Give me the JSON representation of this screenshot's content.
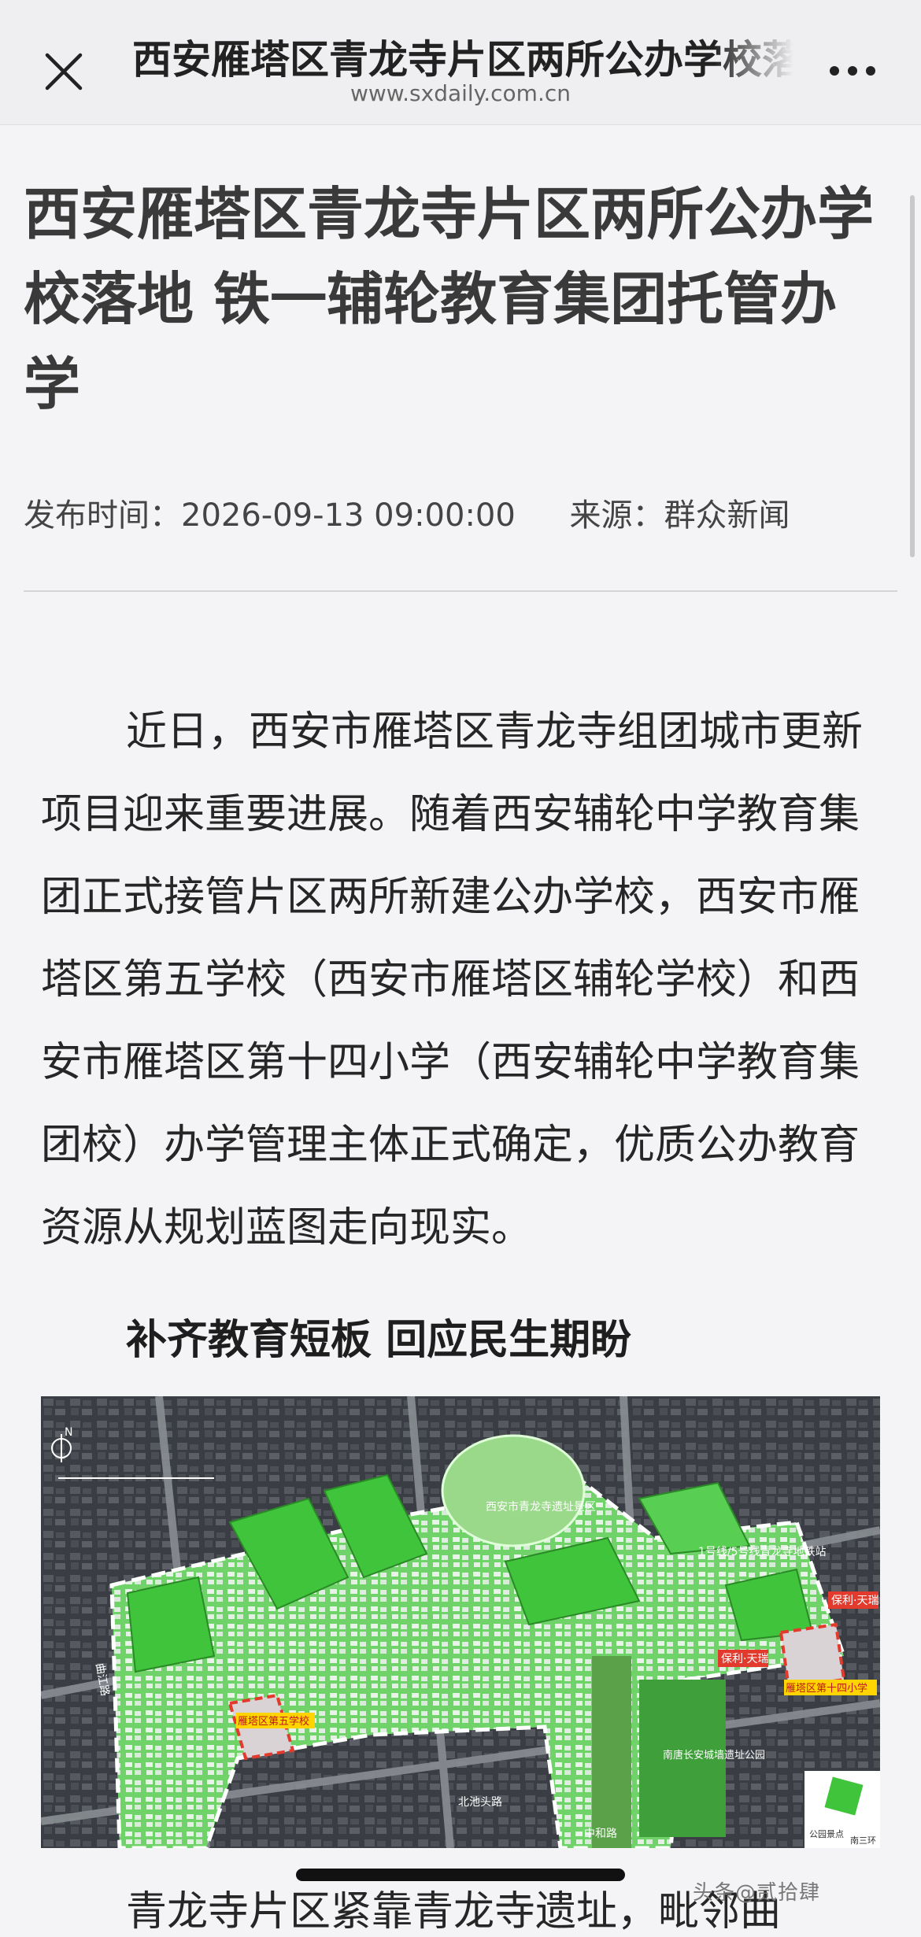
{
  "header": {
    "title": "西安雁塔区青龙寺片区两所公办学校落地 铁一辅轮教育集团托管办学",
    "domain": "www.sxdaily.com.cn"
  },
  "article": {
    "title": "西安雁塔区青龙寺片区两所公办学校落地 铁一辅轮教育集团托管办学",
    "publish_label": "发布时间：",
    "publish_time": "2026-09-13 09:00:00",
    "source_label": "来源：",
    "source": "群众新闻",
    "paragraph1": "近日，西安市雁塔区青龙寺组团城市更新项目迎来重要进展。随着西安辅轮中学教育集团正式接管片区两所新建公办学校，西安市雁塔区第五学校（西安市雁塔区辅轮学校）和西安市雁塔区第十四小学（西安辅轮中学教育集团校）办学管理主体正式确定，优质公办教育资源从规划蓝图走向现实。",
    "section_heading": "补齐教育短板 回应民生期盼",
    "next_paragraph_start": "青龙寺片区紧靠青龙寺遗址，毗邻曲"
  },
  "map": {
    "labels": {
      "site_park": "西安市青龙寺遗址景区",
      "metro_station": "1号线/5号线青龙寺地铁站",
      "poly_tianrui_1": "保利·天瑞",
      "poly_tianrui_2": "保利·天瑞",
      "school_5": "雁塔区第五学校",
      "school_14": "雁塔区第十四小学",
      "tang_park": "南唐长安城墙遗址公园",
      "road_west": "曲江路",
      "road_south": "北池头路",
      "road_mid": "中和路",
      "road_ring": "南三环",
      "legend_box": "公园景点"
    },
    "colors": {
      "green": "#3fc43b",
      "school_red": "#e23b2e",
      "label_yellow": "#ffd400",
      "boundary": "#ffffff"
    }
  },
  "watermark": "头条@贰拾肆"
}
